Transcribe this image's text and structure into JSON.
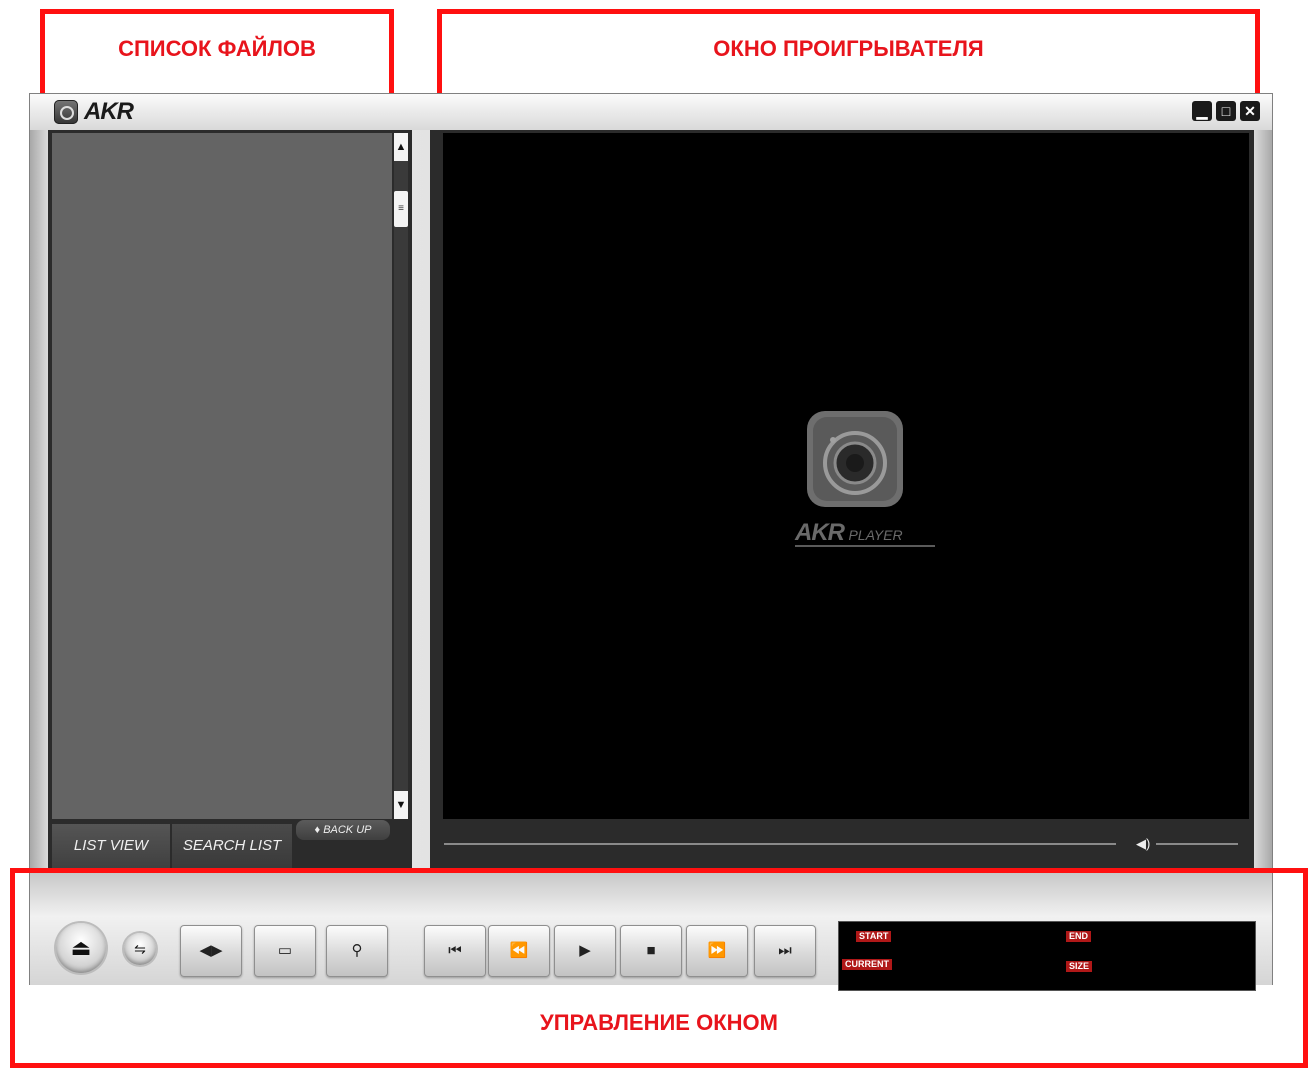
{
  "annotations": {
    "file_list": "СПИСОК ФАЙЛОВ",
    "player_window": "ОКНО ПРОИГРЫВАТЕЛЯ",
    "window_control": "УПРАВЛЕНИЕ ОКНОМ",
    "color": "#ff1010"
  },
  "app": {
    "title": "AKR",
    "window_buttons": {
      "minimize": "▁",
      "maximize": "□",
      "close": "✕"
    }
  },
  "list_panel": {
    "tabs": [
      "LIST VIEW",
      "SEARCH LIST"
    ],
    "backup_label": "BACK UP",
    "scroll_up": "▲",
    "scroll_down": "▼",
    "scroll_thumb": "≡"
  },
  "player": {
    "splash_brand": "AKR",
    "splash_sub": "PLAYER",
    "volume_icon": "◀)"
  },
  "controls": {
    "eject": "⏏",
    "settings": "⇋",
    "buttons": [
      {
        "name": "split-view-button",
        "icon": "◀▶"
      },
      {
        "name": "window-mode-button",
        "icon": "▭"
      },
      {
        "name": "search-button",
        "icon": "⚲"
      },
      {
        "name": "skip-start-button",
        "icon": "⏮"
      },
      {
        "name": "rewind-button",
        "icon": "⏪"
      },
      {
        "name": "play-button",
        "icon": "▶"
      },
      {
        "name": "stop-button",
        "icon": "■"
      },
      {
        "name": "fast-forward-button",
        "icon": "⏩"
      },
      {
        "name": "skip-end-button",
        "icon": "⏭"
      }
    ]
  },
  "info_panel": {
    "start": "START",
    "end": "END",
    "current": "CURRENT",
    "size": "SIZE",
    "tag_color": "#b01818"
  }
}
